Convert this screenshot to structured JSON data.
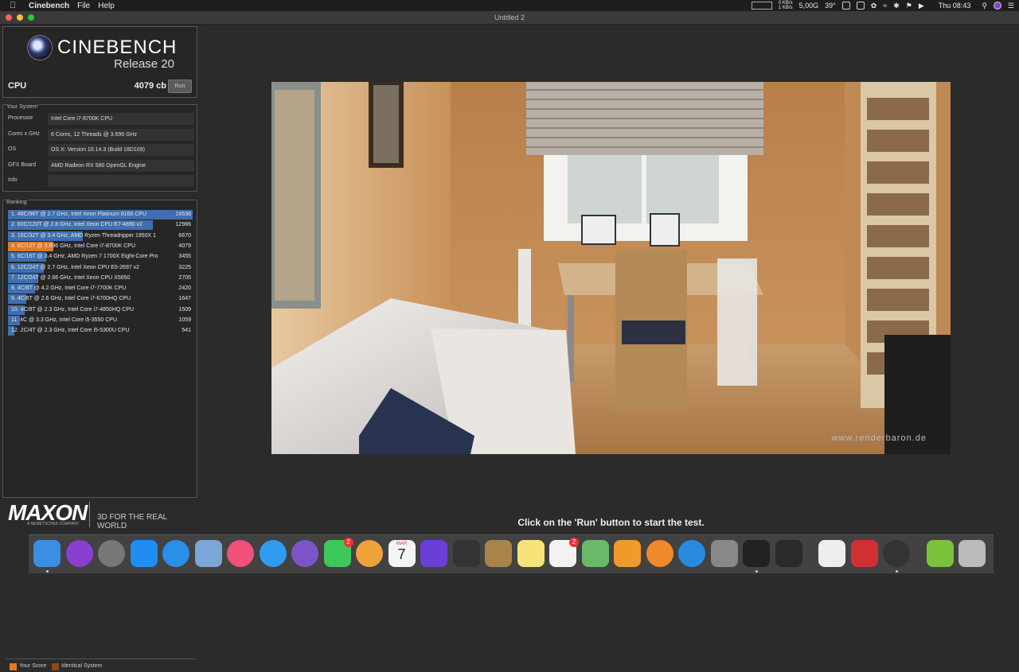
{
  "menubar": {
    "app_name": "Cinebench",
    "items": [
      "File",
      "Help"
    ],
    "net_up": "0 KB/s",
    "net_down": "1 KB/s",
    "memory": "5,00G",
    "temperature": "39°",
    "clock": "Thu 08:43"
  },
  "window": {
    "title": "Untitled 2"
  },
  "brand": {
    "name": "CINEBENCH",
    "release": "Release 20"
  },
  "cpu": {
    "label": "CPU",
    "score": "4079 cb",
    "run_label": "Run"
  },
  "system": {
    "title": "Your System",
    "rows": [
      {
        "key": "Processor",
        "value": "Intel Core i7-8700K CPU"
      },
      {
        "key": "Cores x GHz",
        "value": "6 Cores, 12 Threads @ 3.696 GHz"
      },
      {
        "key": "OS",
        "value": "OS X: Version 10.14.3 (Build 18D109)"
      },
      {
        "key": "GFX Board",
        "value": "AMD Radeon RX 580 OpenGL Engine"
      },
      {
        "key": "Info",
        "value": ""
      }
    ]
  },
  "ranking": {
    "title": "Ranking",
    "max_score": 16536,
    "rows": [
      {
        "label": "1. 48C/96T @ 2.7 GHz, Intel Xeon Platinum 8168 CPU",
        "score": 16536,
        "score_text": "16536",
        "kind": "normal"
      },
      {
        "label": "2. 60C/120T @ 2.8 GHz, Intel Xeon CPU E7-4890 v2",
        "score": 12986,
        "score_text": "12986",
        "kind": "normal"
      },
      {
        "label": "3. 16C/32T @ 3.4 GHz, AMD Ryzen Threadripper 1950X 1",
        "score": 6670,
        "score_text": "6670",
        "kind": "normal"
      },
      {
        "label": "4. 6C/12T @ 3.696 GHz, Intel Core i7-8700K CPU",
        "score": 4079,
        "score_text": "4079",
        "kind": "yours"
      },
      {
        "label": "5. 8C/16T @ 3.4 GHz, AMD Ryzen 7 1700X Eight-Core Pro",
        "score": 3455,
        "score_text": "3455",
        "kind": "normal"
      },
      {
        "label": "6. 12C/24T @ 2.7 GHz, Intel Xeon CPU E5-2697 v2",
        "score": 3225,
        "score_text": "3225",
        "kind": "normal"
      },
      {
        "label": "7. 12C/24T @ 2.66 GHz, Intel Xeon CPU X5650",
        "score": 2705,
        "score_text": "2705",
        "kind": "normal"
      },
      {
        "label": "8. 4C/8T @ 4.2 GHz, Intel Core i7-7700K CPU",
        "score": 2420,
        "score_text": "2420",
        "kind": "normal"
      },
      {
        "label": "9. 4C/8T @ 2.6 GHz, Intel Core i7-6700HQ CPU",
        "score": 1647,
        "score_text": "1647",
        "kind": "normal"
      },
      {
        "label": "10. 4C/8T @ 2.3 GHz, Intel Core i7-4850HQ CPU",
        "score": 1509,
        "score_text": "1509",
        "kind": "normal"
      },
      {
        "label": "11. 4C @ 3.3 GHz, Intel Core i5-3550 CPU",
        "score": 1059,
        "score_text": "1059",
        "kind": "normal"
      },
      {
        "label": "12. 2C/4T @ 2.3 GHz, Intel Core i5-5300U CPU",
        "score": 541,
        "score_text": "541",
        "kind": "normal"
      }
    ]
  },
  "legend": {
    "your_score": "Your Score",
    "identical": "Identical System"
  },
  "maxon": {
    "word": "MAXON",
    "sub": "A NEMETSCHEK COMPANY",
    "tagline": "3D FOR THE REAL WORLD"
  },
  "render": {
    "watermark": "www.renderbaron.de"
  },
  "status": {
    "text": "Click on the 'Run' button to start the test."
  },
  "colors": {
    "bar_normal": "#3f6fae",
    "bar_yours": "#e07a28",
    "bar_identical": "#8a4a1c"
  },
  "dock": {
    "calendar_month": "MAR",
    "calendar_day": "7",
    "facetime_badge": "2",
    "reminders_badge": "2",
    "icons": [
      {
        "name": "finder-icon",
        "color": "#3b8fe0"
      },
      {
        "name": "siri-icon",
        "color": "#8a3fd0"
      },
      {
        "name": "launchpad-icon",
        "color": "#777"
      },
      {
        "name": "app-store-icon",
        "color": "#1f8ef0"
      },
      {
        "name": "safari-icon",
        "color": "#2a8fe8"
      },
      {
        "name": "mail-icon",
        "color": "#7aa6d8"
      },
      {
        "name": "itunes-icon",
        "color": "#f0507a"
      },
      {
        "name": "messages-icon",
        "color": "#2f9cf0"
      },
      {
        "name": "viber-icon",
        "color": "#7b55c8"
      },
      {
        "name": "facetime-icon",
        "color": "#3cc85a"
      },
      {
        "name": "photos-icon",
        "color": "#f0a23a"
      },
      {
        "name": "calendar-icon",
        "color": "#f4f4f4"
      },
      {
        "name": "imovie-icon",
        "color": "#6a3fd8"
      },
      {
        "name": "final-cut-icon",
        "color": "#333"
      },
      {
        "name": "contacts-icon",
        "color": "#a8844a"
      },
      {
        "name": "notes-icon",
        "color": "#f6e47a"
      },
      {
        "name": "reminders-icon",
        "color": "#f2f2f2"
      },
      {
        "name": "maps-icon",
        "color": "#6ab86a"
      },
      {
        "name": "home-icon",
        "color": "#f09a2a"
      },
      {
        "name": "books-icon",
        "color": "#f08a2a"
      },
      {
        "name": "utility-icon",
        "color": "#2a8ae0"
      },
      {
        "name": "system-preferences-icon",
        "color": "#888"
      },
      {
        "name": "terminal-icon",
        "color": "#222"
      },
      {
        "name": "activity-monitor-icon",
        "color": "#2a2a2a"
      },
      {
        "name": "archive-icon",
        "color": "#eee"
      },
      {
        "name": "tools-icon",
        "color": "#d03030"
      },
      {
        "name": "cinebench-icon",
        "color": "#333"
      },
      {
        "name": "downloads-icon",
        "color": "#7ac23a"
      },
      {
        "name": "trash-icon",
        "color": "#bbb"
      }
    ]
  }
}
